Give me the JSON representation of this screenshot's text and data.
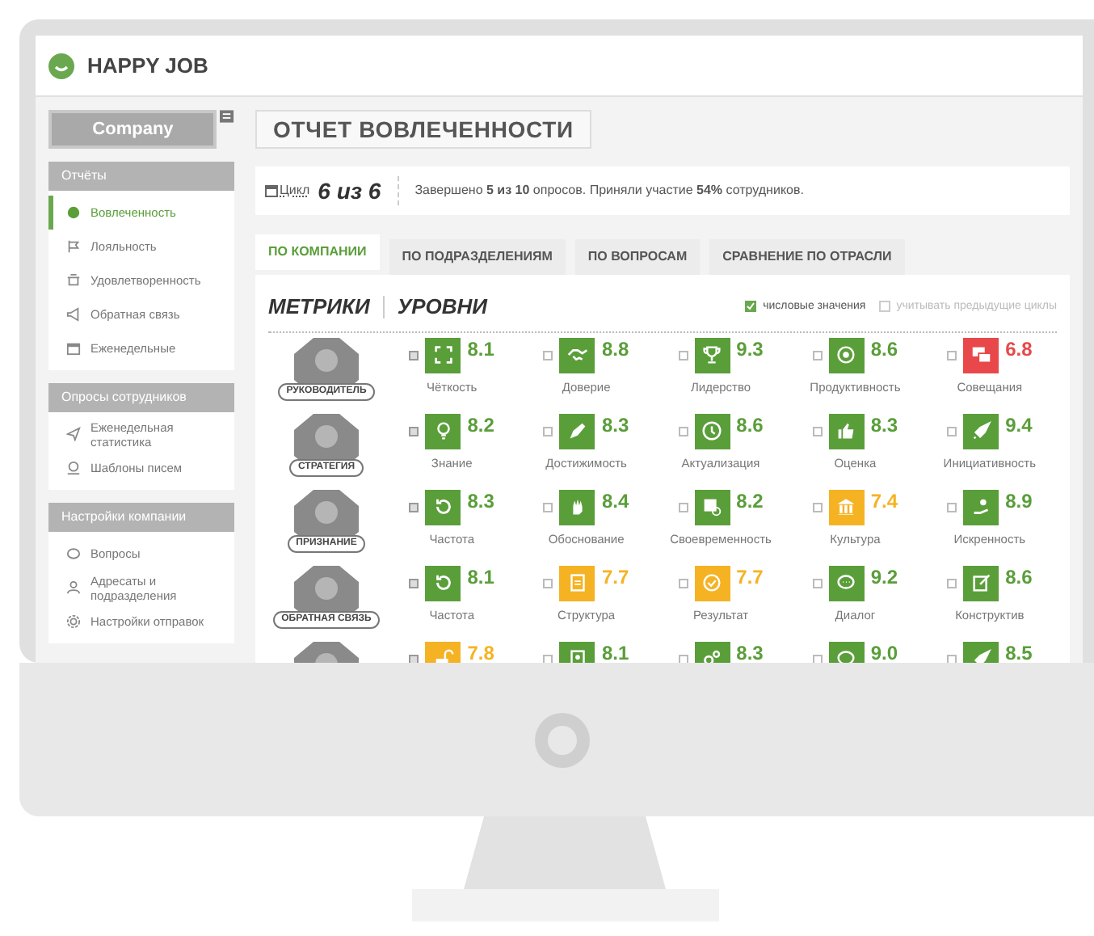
{
  "app": {
    "name": "HAPPY JOB"
  },
  "sidebar": {
    "company": "Company",
    "sections": [
      {
        "title": "Отчёты",
        "items": [
          {
            "label": "Вовлеченность",
            "selected": true
          },
          {
            "label": "Лояльность",
            "selected": false
          },
          {
            "label": "Удовлетворенность",
            "selected": false
          },
          {
            "label": "Обратная связь",
            "selected": false
          },
          {
            "label": "Еженедельные",
            "selected": false
          }
        ]
      },
      {
        "title": "Опросы сотрудников",
        "items": [
          {
            "label": "Еженедельная статистика",
            "selected": false
          },
          {
            "label": "Шаблоны писем",
            "selected": false
          }
        ]
      },
      {
        "title": "Настройки компании",
        "items": [
          {
            "label": "Вопросы",
            "selected": false
          },
          {
            "label": "Адресаты и подразделения",
            "selected": false
          },
          {
            "label": "Настройки отправок",
            "selected": false
          }
        ]
      }
    ]
  },
  "page_title": "ОТЧЕТ ВОВЛЕЧЕННОСТИ",
  "summary": {
    "cycle_label": "Цикл",
    "cycle_value": "6 из 6",
    "text": "Завершено **5 из 10** опросов. Приняли участие **54%** сотрудников."
  },
  "tabs": [
    {
      "label": "ПО КОМПАНИИ",
      "selected": true
    },
    {
      "label": "ПО ПОДРАЗДЕЛЕНИЯМ",
      "selected": false
    },
    {
      "label": "ПО ВОПРОСАМ",
      "selected": false
    },
    {
      "label": "СРАВНЕНИЕ ПО ОТРАСЛИ",
      "selected": false
    }
  ],
  "view_tabs": [
    "МЕТРИКИ",
    "УРОВНИ"
  ],
  "options": [
    {
      "label": "числовые значения",
      "checked": true
    },
    {
      "label": "учитывать предыдущие циклы",
      "checked": false
    }
  ],
  "categories": [
    {
      "label": "РУКОВОДИТЕЛЬ",
      "metrics": [
        {
          "name": "Чёткость",
          "value": "8.1",
          "checked": true,
          "color": "#5a9e3a"
        },
        {
          "name": "Доверие",
          "value": "8.8",
          "checked": false,
          "color": "#5a9e3a"
        },
        {
          "name": "Лидерство",
          "value": "9.3",
          "checked": false,
          "color": "#5a9e3a"
        },
        {
          "name": "Продуктивность",
          "value": "8.6",
          "checked": false,
          "color": "#5a9e3a"
        },
        {
          "name": "Совещания",
          "value": "6.8",
          "checked": false,
          "color": "#e8484a"
        }
      ]
    },
    {
      "label": "СТРАТЕГИЯ",
      "metrics": [
        {
          "name": "Знание",
          "value": "8.2",
          "checked": true,
          "color": "#5a9e3a"
        },
        {
          "name": "Достижимость",
          "value": "8.3",
          "checked": false,
          "color": "#5a9e3a"
        },
        {
          "name": "Актуализация",
          "value": "8.6",
          "checked": false,
          "color": "#5a9e3a"
        },
        {
          "name": "Оценка",
          "value": "8.3",
          "checked": false,
          "color": "#5a9e3a"
        },
        {
          "name": "Инициативность",
          "value": "9.4",
          "checked": false,
          "color": "#5a9e3a"
        }
      ]
    },
    {
      "label": "ПРИЗНАНИЕ",
      "metrics": [
        {
          "name": "Частота",
          "value": "8.3",
          "checked": true,
          "color": "#5a9e3a"
        },
        {
          "name": "Обоснование",
          "value": "8.4",
          "checked": false,
          "color": "#5a9e3a"
        },
        {
          "name": "Своевременность",
          "value": "8.2",
          "checked": false,
          "color": "#5a9e3a"
        },
        {
          "name": "Культура",
          "value": "7.4",
          "checked": false,
          "color": "#f5b323"
        },
        {
          "name": "Искренность",
          "value": "8.9",
          "checked": false,
          "color": "#5a9e3a"
        }
      ]
    },
    {
      "label": "ОБРАТНАЯ СВЯЗЬ",
      "metrics": [
        {
          "name": "Частота",
          "value": "8.1",
          "checked": true,
          "color": "#5a9e3a"
        },
        {
          "name": "Структура",
          "value": "7.7",
          "checked": false,
          "color": "#f5b323"
        },
        {
          "name": "Результат",
          "value": "7.7",
          "checked": false,
          "color": "#f5b323"
        },
        {
          "name": "Диалог",
          "value": "9.2",
          "checked": false,
          "color": "#5a9e3a"
        },
        {
          "name": "Конструктив",
          "value": "8.6",
          "checked": false,
          "color": "#5a9e3a"
        }
      ]
    },
    {
      "metrics": [
        {
          "value": "7.8",
          "checked": true,
          "color": "#f5b323"
        },
        {
          "value": "8.1",
          "checked": false,
          "color": "#5a9e3a"
        },
        {
          "value": "8.3",
          "checked": false,
          "color": "#5a9e3a"
        },
        {
          "value": "9.0",
          "checked": false,
          "color": "#5a9e3a"
        },
        {
          "value": "8.5",
          "checked": false,
          "color": "#5a9e3a"
        }
      ]
    }
  ]
}
